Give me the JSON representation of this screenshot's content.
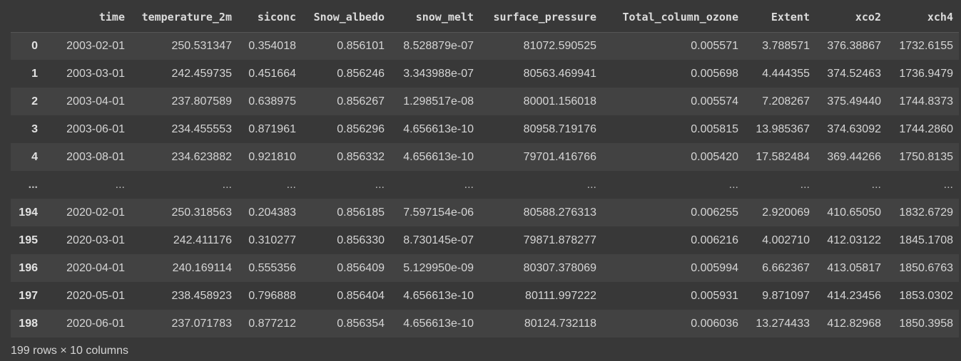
{
  "table": {
    "columns": [
      "",
      "time",
      "temperature_2m",
      "siconc",
      "Snow_albedo",
      "snow_melt",
      "surface_pressure",
      "Total_column_ozone",
      "Extent",
      "xco2",
      "xch4"
    ],
    "rows": [
      {
        "index": "0",
        "cells": [
          "2003-02-01",
          "250.531347",
          "0.354018",
          "0.856101",
          "8.528879e-07",
          "81072.590525",
          "0.005571",
          "3.788571",
          "376.38867",
          "1732.6155"
        ]
      },
      {
        "index": "1",
        "cells": [
          "2003-03-01",
          "242.459735",
          "0.451664",
          "0.856246",
          "3.343988e-07",
          "80563.469941",
          "0.005698",
          "4.444355",
          "374.52463",
          "1736.9479"
        ]
      },
      {
        "index": "2",
        "cells": [
          "2003-04-01",
          "237.807589",
          "0.638975",
          "0.856267",
          "1.298517e-08",
          "80001.156018",
          "0.005574",
          "7.208267",
          "375.49440",
          "1744.8373"
        ]
      },
      {
        "index": "3",
        "cells": [
          "2003-06-01",
          "234.455553",
          "0.871961",
          "0.856296",
          "4.656613e-10",
          "80958.719176",
          "0.005815",
          "13.985367",
          "374.63092",
          "1744.2860"
        ]
      },
      {
        "index": "4",
        "cells": [
          "2003-08-01",
          "234.623882",
          "0.921810",
          "0.856332",
          "4.656613e-10",
          "79701.416766",
          "0.005420",
          "17.582484",
          "369.44266",
          "1750.8135"
        ]
      },
      {
        "index": "...",
        "cells": [
          "...",
          "...",
          "...",
          "...",
          "...",
          "...",
          "...",
          "...",
          "...",
          "..."
        ]
      },
      {
        "index": "194",
        "cells": [
          "2020-02-01",
          "250.318563",
          "0.204383",
          "0.856185",
          "7.597154e-06",
          "80588.276313",
          "0.006255",
          "2.920069",
          "410.65050",
          "1832.6729"
        ]
      },
      {
        "index": "195",
        "cells": [
          "2020-03-01",
          "242.411176",
          "0.310277",
          "0.856330",
          "8.730145e-07",
          "79871.878277",
          "0.006216",
          "4.002710",
          "412.03122",
          "1845.1708"
        ]
      },
      {
        "index": "196",
        "cells": [
          "2020-04-01",
          "240.169114",
          "0.555356",
          "0.856409",
          "5.129950e-09",
          "80307.378069",
          "0.005994",
          "6.662367",
          "413.05817",
          "1850.6763"
        ]
      },
      {
        "index": "197",
        "cells": [
          "2020-05-01",
          "238.458923",
          "0.796888",
          "0.856404",
          "4.656613e-10",
          "80111.997222",
          "0.005931",
          "9.871097",
          "414.23456",
          "1853.0302"
        ]
      },
      {
        "index": "198",
        "cells": [
          "2020-06-01",
          "237.071783",
          "0.877212",
          "0.856354",
          "4.656613e-10",
          "80124.732118",
          "0.006036",
          "13.274433",
          "412.82968",
          "1850.3958"
        ]
      }
    ],
    "summary": "199 rows × 10 columns"
  }
}
